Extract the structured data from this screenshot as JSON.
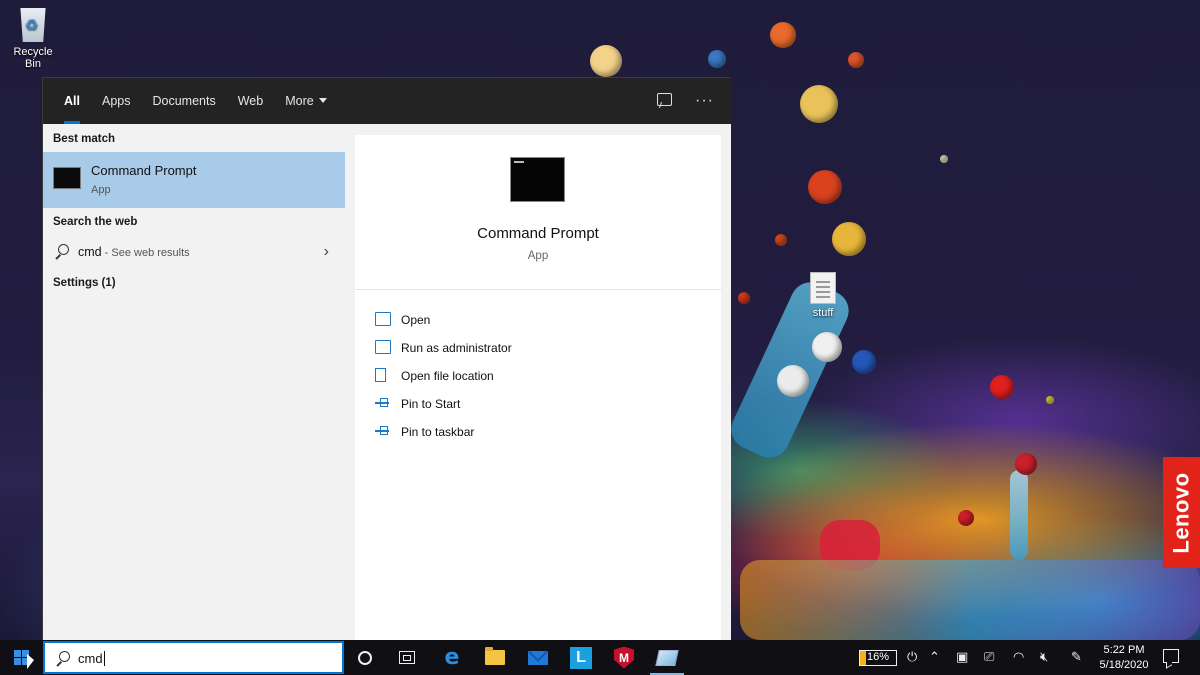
{
  "desktop": {
    "recycle_bin_label": "Recycle Bin",
    "stuff_label": "stuff",
    "brand_badge": "Lenovo"
  },
  "search": {
    "filters": {
      "all": "All",
      "apps": "Apps",
      "documents": "Documents",
      "web": "Web",
      "more": "More"
    },
    "more_options_label": "···",
    "results": {
      "best_match_heading": "Best match",
      "best_match_title": "Command Prompt",
      "best_match_type": "App",
      "search_web_heading": "Search the web",
      "web_query": "cmd",
      "web_suffix": " - See web results",
      "settings_heading": "Settings (1)"
    },
    "preview": {
      "title": "Command Prompt",
      "type": "App",
      "actions": [
        {
          "label": "Open",
          "icon": "open-icon"
        },
        {
          "label": "Run as administrator",
          "icon": "shield-icon"
        },
        {
          "label": "Open file location",
          "icon": "file-location-icon"
        },
        {
          "label": "Pin to Start",
          "icon": "pin-icon"
        },
        {
          "label": "Pin to taskbar",
          "icon": "pin-icon"
        }
      ]
    }
  },
  "taskbar": {
    "search_value": "cmd",
    "mcafee_letter": "M",
    "l_app_letter": "L",
    "battery_percent": "16%",
    "battery_level": 0.16,
    "time": "5:22 PM",
    "date": "5/18/2020"
  },
  "colors": {
    "accent": "#0078d7",
    "selection": "#a9cbea",
    "action_icon": "#1e78c8"
  }
}
